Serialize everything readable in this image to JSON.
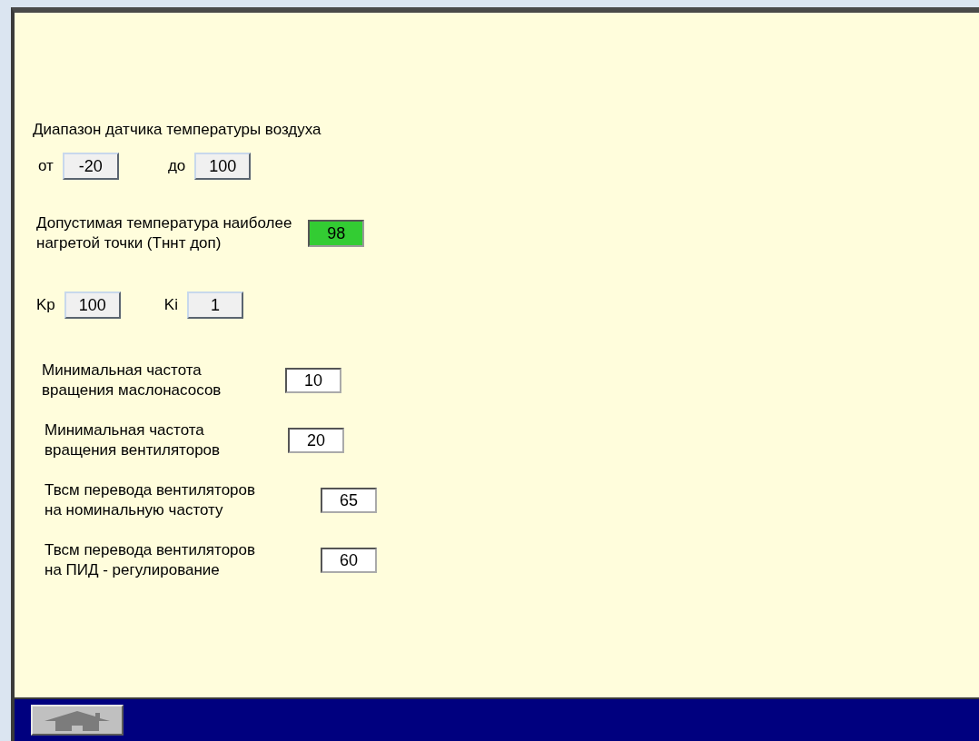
{
  "range": {
    "title": "Диапазон датчика температуры воздуха",
    "from": {
      "label": "от",
      "value": "-20"
    },
    "to": {
      "label": "до",
      "value": "100"
    }
  },
  "max_temp": {
    "label": "Допустимая температура наиболее\nнагретой точки (Тннт доп)",
    "value": "98"
  },
  "pid": [
    {
      "label": "Kp",
      "value": "100"
    },
    {
      "label": "Ki",
      "value": "1"
    }
  ],
  "settings": [
    {
      "label": "Минимальная частота\nвращения маслонасосов",
      "value": "10"
    },
    {
      "label": "Минимальная частота\nвращения вентиляторов",
      "value": "20"
    },
    {
      "label": "Твсм перевода вентиляторов\nна номинальную частоту",
      "value": "65"
    },
    {
      "label": "Твсм перевода вентиляторов\nна ПИД - регулирование",
      "value": "60"
    }
  ]
}
